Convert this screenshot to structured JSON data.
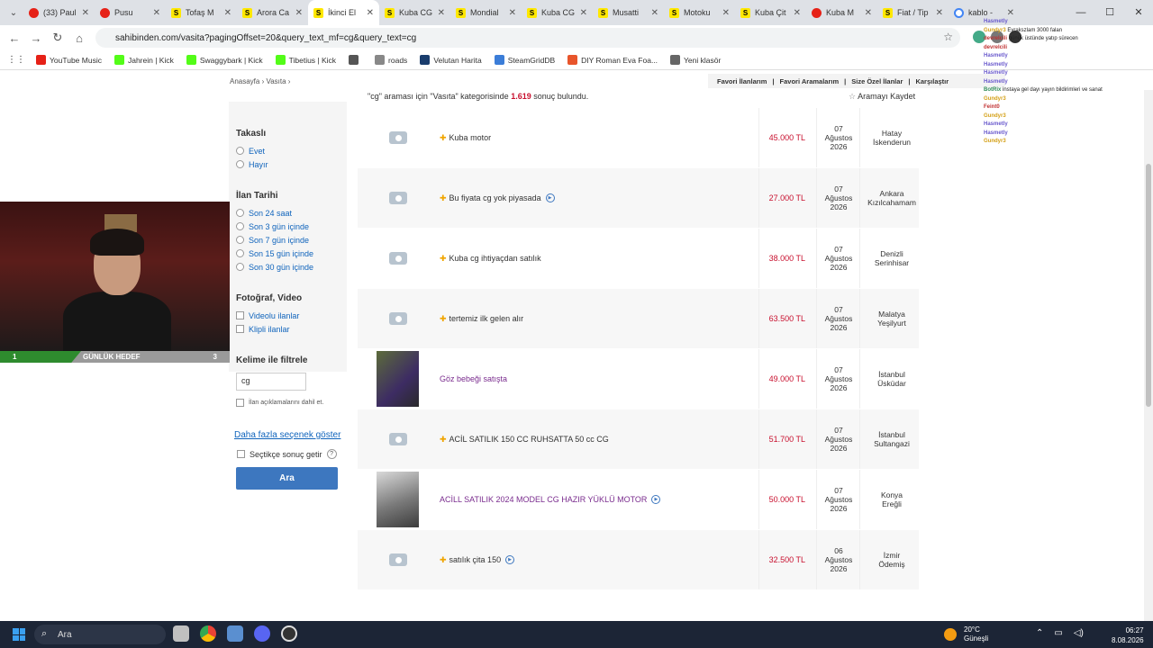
{
  "browser": {
    "tabs": [
      {
        "label": "(33) Paul",
        "icon": "youtube-icon"
      },
      {
        "label": "Pusu",
        "icon": "youtube-icon"
      },
      {
        "label": "Tofaş M",
        "icon": "sahibinden-icon"
      },
      {
        "label": "Arora Ca",
        "icon": "sahibinden-icon"
      },
      {
        "label": "İkinci El",
        "icon": "sahibinden-icon"
      },
      {
        "label": "Kuba CG",
        "icon": "sahibinden-icon"
      },
      {
        "label": "Mondial",
        "icon": "sahibinden-icon"
      },
      {
        "label": "Kuba CG",
        "icon": "sahibinden-icon"
      },
      {
        "label": "Musatti",
        "icon": "sahibinden-icon"
      },
      {
        "label": "Motoku",
        "icon": "sahibinden-icon"
      },
      {
        "label": "Kuba Çit",
        "icon": "sahibinden-icon"
      },
      {
        "label": "Kuba M",
        "icon": "youtube-icon"
      },
      {
        "label": "Fiat / Tip",
        "icon": "sahibinden-icon"
      },
      {
        "label": "kablo -",
        "icon": "google-icon"
      }
    ],
    "url": "sahibinden.com/vasita?pagingOffset=20&query_text_mf=cg&query_text=cg",
    "bookmarks": [
      {
        "label": "YouTube Music",
        "color": "#e62117"
      },
      {
        "label": "Jahrein | Kick",
        "color": "#53fc18"
      },
      {
        "label": "Swaggybark | Kick",
        "color": "#53fc18"
      },
      {
        "label": "Tibetius | Kick",
        "color": "#53fc18"
      },
      {
        "label": "",
        "color": "#555555"
      },
      {
        "label": "roads",
        "color": "#888888"
      },
      {
        "label": "Velutan Harita",
        "color": "#1a3d6d"
      },
      {
        "label": "SteamGridDB",
        "color": "#3b7dd8"
      },
      {
        "label": "DIY Roman Eva Foa...",
        "color": "#e8552b"
      },
      {
        "label": "Yeni klasör",
        "color": "#666666"
      }
    ]
  },
  "page": {
    "breadcrumb": [
      "Anasayfa",
      "Vasıta"
    ],
    "user_links": [
      "Favori İlanlarım",
      "Favori Aramalarım",
      "Size Özel İlanlar",
      "Karşılaştır"
    ],
    "result_text_pre": "\"cg\" araması için \"Vasıta\" kategorisinde",
    "result_count": "1.619",
    "result_text_post": "sonuç bulundu.",
    "save_search": "Aramayı Kaydet",
    "sidebar": {
      "trade_title": "Takaslı",
      "trade_options": [
        "Evet",
        "Hayır"
      ],
      "date_title": "İlan Tarihi",
      "date_options": [
        "Son 24 saat",
        "Son 3 gün içinde",
        "Son 7 gün içinde",
        "Son 15 gün içinde",
        "Son 30 gün içinde"
      ],
      "media_title": "Fotoğraf, Video",
      "media_options": [
        "Videolu ilanlar",
        "Klipli ilanlar"
      ],
      "keyword_title": "Kelime ile filtrele",
      "keyword_value": "cg",
      "keyword_desc": "İlan açıklamalarını dahil et.",
      "more_options": "Daha fazla seçenek göster",
      "select_results": "Seçtikçe sonuç getir",
      "help": "?",
      "search_button": "Ara"
    },
    "listings": [
      {
        "title": "Kuba motor",
        "price": "45.000 TL",
        "date": [
          "07",
          "Ağustos",
          "2026"
        ],
        "location": [
          "Hatay",
          "İskenderun"
        ],
        "photo": false,
        "plus": true,
        "video": false
      },
      {
        "title": "Bu fiyata cg yok piyasada",
        "price": "27.000 TL",
        "date": [
          "07",
          "Ağustos",
          "2026"
        ],
        "location": [
          "Ankara",
          "Kızılcahamam"
        ],
        "photo": false,
        "plus": true,
        "video": true
      },
      {
        "title": "Kuba cg ihtiyaçdan satılık",
        "price": "38.000 TL",
        "date": [
          "07",
          "Ağustos",
          "2026"
        ],
        "location": [
          "Denizli",
          "Serinhisar"
        ],
        "photo": false,
        "plus": true,
        "video": false
      },
      {
        "title": "tertemiz ilk gelen alır",
        "price": "63.500 TL",
        "date": [
          "07",
          "Ağustos",
          "2026"
        ],
        "location": [
          "Malatya",
          "Yeşilyurt"
        ],
        "photo": false,
        "plus": true,
        "video": false
      },
      {
        "title": "Göz bebeği satışta",
        "price": "49.000 TL",
        "date": [
          "07",
          "Ağustos",
          "2026"
        ],
        "location": [
          "İstanbul",
          "Üsküdar"
        ],
        "photo": true,
        "plus": false,
        "video": false
      },
      {
        "title": "ACİL SATILIK 150 CC RUHSATTA 50 cc CG",
        "price": "51.700 TL",
        "date": [
          "07",
          "Ağustos",
          "2026"
        ],
        "location": [
          "İstanbul",
          "Sultangazi"
        ],
        "photo": false,
        "plus": true,
        "video": false
      },
      {
        "title": "ACİLL SATILIK 2024 MODEL CG HAZIR YÜKLÜ MOTOR",
        "price": "50.000 TL",
        "date": [
          "07",
          "Ağustos",
          "2026"
        ],
        "location": [
          "Konya",
          "Ereğli"
        ],
        "photo": true,
        "plus": false,
        "video": true
      },
      {
        "title": "satılık çita 150",
        "price": "32.500 TL",
        "date": [
          "06",
          "Ağustos",
          "2026"
        ],
        "location": [
          "İzmir",
          "Ödemiş"
        ],
        "photo": false,
        "plus": true,
        "video": true
      }
    ]
  },
  "stream": {
    "goal_start": "1",
    "goal_label": "GÜNLÜK HEDEF",
    "goal_end": "3",
    "chat": [
      {
        "user": "Hasmetly",
        "text": ""
      },
      {
        "user": "Gundyr3",
        "text": "Eyrakszlam 3000 falan"
      },
      {
        "user": "devrelcili",
        "text": "günük üstünde yatıp sürecen"
      },
      {
        "user": "devrelcili",
        "text": ""
      },
      {
        "user": "Hasmetly",
        "text": ""
      },
      {
        "user": "Hasmetly",
        "text": ""
      },
      {
        "user": "Hasmetly",
        "text": ""
      },
      {
        "user": "Hasmetly",
        "text": ""
      },
      {
        "user": "BotRix",
        "text": "instaya gel dayı yayın bildirimleri ve sanat"
      },
      {
        "user": "Gundyr3",
        "text": ""
      },
      {
        "user": "Feint0",
        "text": ""
      },
      {
        "user": "Gundyr3",
        "text": ""
      },
      {
        "user": "Hasmetly",
        "text": ""
      },
      {
        "user": "Hasmetly",
        "text": ""
      },
      {
        "user": "Gundyr3",
        "text": ""
      }
    ]
  },
  "taskbar": {
    "search": "Ara",
    "weather_temp": "20°C",
    "weather_desc": "Güneşli",
    "time": "06:27",
    "date": "8.08.2026"
  }
}
